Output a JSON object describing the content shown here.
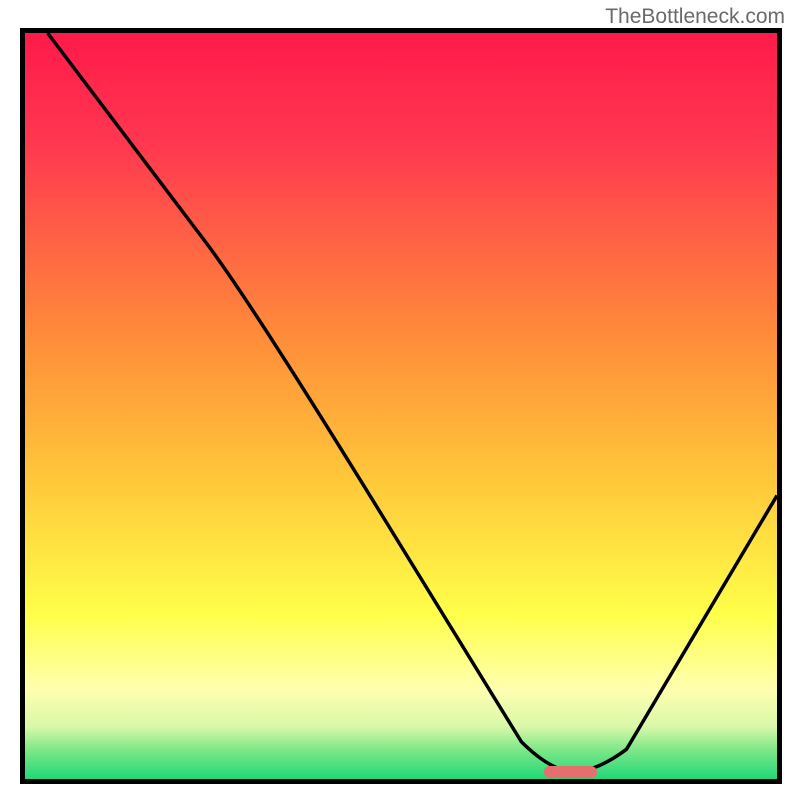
{
  "watermark": "TheBottleneck.com",
  "chart_data": {
    "type": "line",
    "title": "",
    "xlabel": "",
    "ylabel": "",
    "xlim": [
      0,
      100
    ],
    "ylim": [
      0,
      100
    ],
    "curve": [
      {
        "x": 3,
        "y": 100
      },
      {
        "x": 24,
        "y": 72
      },
      {
        "x": 30,
        "y": 64
      },
      {
        "x": 66,
        "y": 5
      },
      {
        "x": 70,
        "y": 1
      },
      {
        "x": 76,
        "y": 1
      },
      {
        "x": 80,
        "y": 4
      },
      {
        "x": 100,
        "y": 38
      }
    ],
    "gradient_stops": [
      {
        "pos": 0,
        "color": "#ff1a4a"
      },
      {
        "pos": 15,
        "color": "#ff3850"
      },
      {
        "pos": 40,
        "color": "#ff8a3a"
      },
      {
        "pos": 60,
        "color": "#ffc83a"
      },
      {
        "pos": 78,
        "color": "#ffff4a"
      },
      {
        "pos": 88,
        "color": "#ffffb0"
      },
      {
        "pos": 93,
        "color": "#d8f8a8"
      },
      {
        "pos": 96,
        "color": "#80e888"
      },
      {
        "pos": 100,
        "color": "#20d878"
      }
    ],
    "marker": {
      "x_start": 69,
      "x_end": 76,
      "y": 0.5
    }
  }
}
